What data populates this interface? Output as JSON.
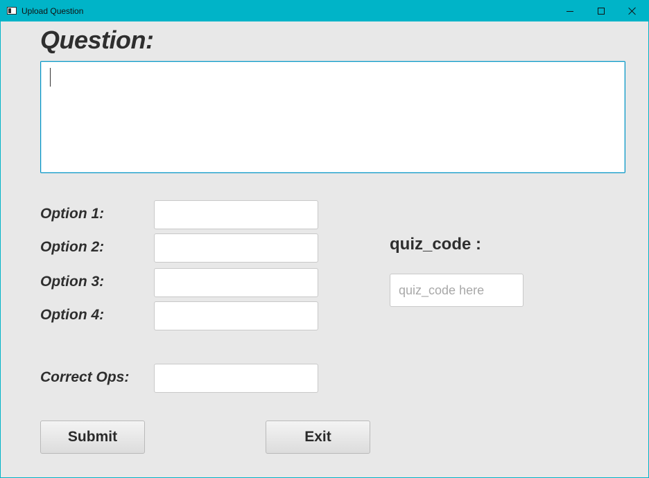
{
  "window": {
    "title": "Upload Question",
    "app_icon": "window-app-icon",
    "controls": [
      "minimize-icon",
      "maximize-icon",
      "close-icon"
    ]
  },
  "question": {
    "label": "Question:",
    "value": ""
  },
  "options": [
    {
      "label": "Option 1:",
      "value": ""
    },
    {
      "label": "Option 2:",
      "value": ""
    },
    {
      "label": "Option 3:",
      "value": ""
    },
    {
      "label": "Option 4:",
      "value": ""
    }
  ],
  "correct": {
    "label": "Correct Ops:",
    "value": ""
  },
  "quiz_code": {
    "label": "quiz_code :",
    "placeholder": "quiz_code here",
    "value": ""
  },
  "buttons": {
    "submit": "Submit",
    "exit": "Exit"
  },
  "colors": {
    "titlebar": "#00b4c8",
    "background": "#e8e8e8",
    "focus_border": "#0093c4",
    "label_text": "#2e2e2e"
  }
}
